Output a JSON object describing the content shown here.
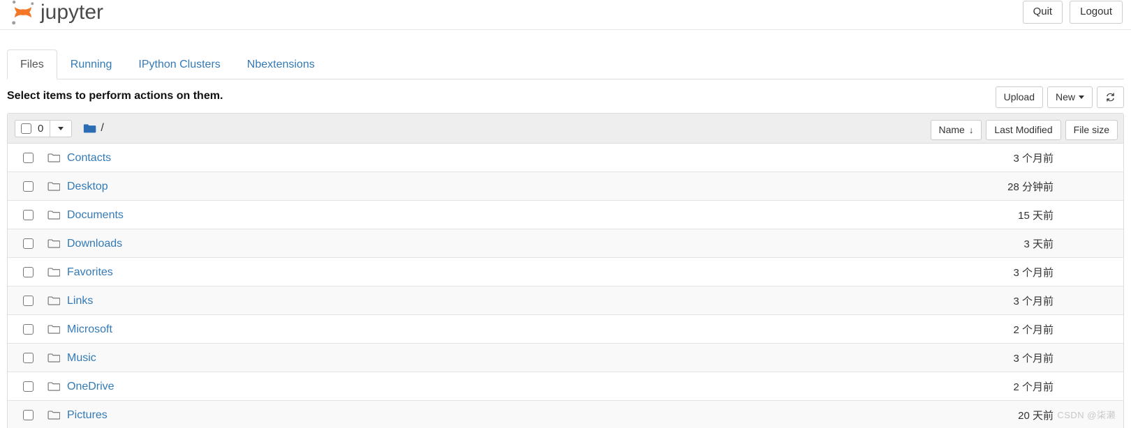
{
  "header": {
    "brand_text": "jupyter",
    "logo_icon": "jupyter-logo",
    "quit_label": "Quit",
    "logout_label": "Logout"
  },
  "tabs": [
    {
      "label": "Files",
      "active": true
    },
    {
      "label": "Running",
      "active": false
    },
    {
      "label": "IPython Clusters",
      "active": false
    },
    {
      "label": "Nbextensions",
      "active": false
    }
  ],
  "action_bar": {
    "note": "Select items to perform actions on them.",
    "upload_label": "Upload",
    "new_label": "New",
    "new_caret_icon": "caret-down-icon",
    "refresh_icon": "refresh-icon"
  },
  "list_header": {
    "select_all_checkbox_icon": "checkbox-unchecked-icon",
    "selected_count": "0",
    "select_caret_icon": "caret-down-icon",
    "breadcrumb_folder_icon": "folder-solid-icon",
    "breadcrumb_path": "/",
    "sort_name": "Name",
    "sort_name_arrow": "↓",
    "sort_last_modified": "Last Modified",
    "sort_file_size": "File size"
  },
  "files": [
    {
      "name": "Contacts",
      "icon": "folder-icon",
      "modified": "3 个月前",
      "size": ""
    },
    {
      "name": "Desktop",
      "icon": "folder-icon",
      "modified": "28 分钟前",
      "size": ""
    },
    {
      "name": "Documents",
      "icon": "folder-icon",
      "modified": "15 天前",
      "size": ""
    },
    {
      "name": "Downloads",
      "icon": "folder-icon",
      "modified": "3 天前",
      "size": ""
    },
    {
      "name": "Favorites",
      "icon": "folder-icon",
      "modified": "3 个月前",
      "size": ""
    },
    {
      "name": "Links",
      "icon": "folder-icon",
      "modified": "3 个月前",
      "size": ""
    },
    {
      "name": "Microsoft",
      "icon": "folder-icon",
      "modified": "2 个月前",
      "size": ""
    },
    {
      "name": "Music",
      "icon": "folder-icon",
      "modified": "3 个月前",
      "size": ""
    },
    {
      "name": "OneDrive",
      "icon": "folder-icon",
      "modified": "2 个月前",
      "size": ""
    },
    {
      "name": "Pictures",
      "icon": "folder-icon",
      "modified": "20 天前",
      "size": ""
    }
  ],
  "watermark": "CSDN @柒濑",
  "colors": {
    "link": "#337ab7",
    "brand_orange": "#f37726",
    "brand_gray": "#9e9e9e",
    "header_bg": "#eeeeee",
    "border": "#dddddd"
  }
}
